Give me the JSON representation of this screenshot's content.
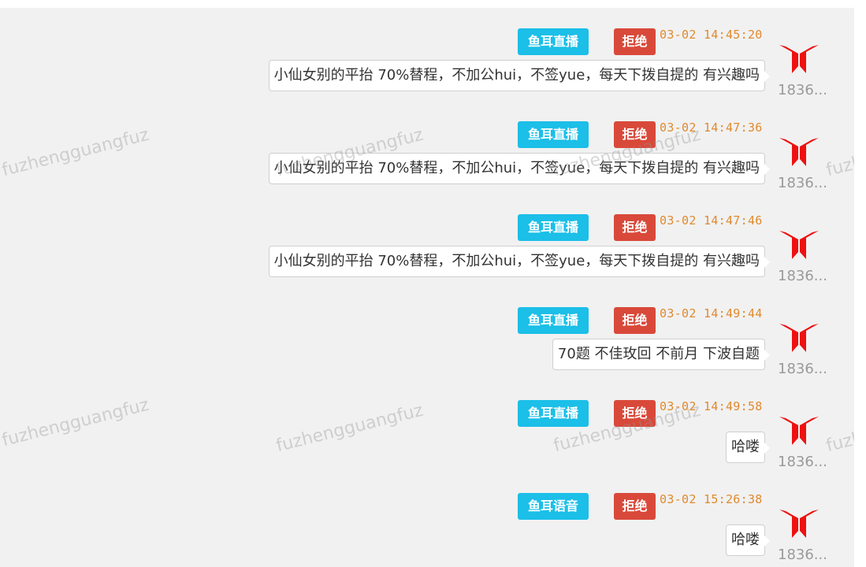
{
  "watermark": "fuzhengguangfuz",
  "colors": {
    "panel_bg": "#f1f1f1",
    "source_tag": "#1bbfe8",
    "reject_tag": "#d9493a",
    "timestamp": "#e08a2e",
    "avatar": "#ee1111"
  },
  "messages": [
    {
      "source": "鱼耳直播",
      "action": "拒绝",
      "time": "03-02 14:45:20",
      "text": "小仙女别的平抬 70%替程，不加公hui，不签yue，每天下拨自提的 有兴趣吗",
      "sender": "1836..."
    },
    {
      "source": "鱼耳直播",
      "action": "拒绝",
      "time": "03-02 14:47:36",
      "text": "小仙女别的平抬 70%替程，不加公hui，不签yue，每天下拨自提的 有兴趣吗",
      "sender": "1836..."
    },
    {
      "source": "鱼耳直播",
      "action": "拒绝",
      "time": "03-02 14:47:46",
      "text": "小仙女别的平抬 70%替程，不加公hui，不签yue，每天下拨自提的 有兴趣吗",
      "sender": "1836..."
    },
    {
      "source": "鱼耳直播",
      "action": "拒绝",
      "time": "03-02 14:49:44",
      "text": "70题 不佳玫回 不前月 下波自题",
      "sender": "1836..."
    },
    {
      "source": "鱼耳直播",
      "action": "拒绝",
      "time": "03-02 14:49:58",
      "text": "哈喽",
      "sender": "1836..."
    },
    {
      "source": "鱼耳语音",
      "action": "拒绝",
      "time": "03-02 15:26:38",
      "text": "哈喽",
      "sender": "1836..."
    }
  ]
}
